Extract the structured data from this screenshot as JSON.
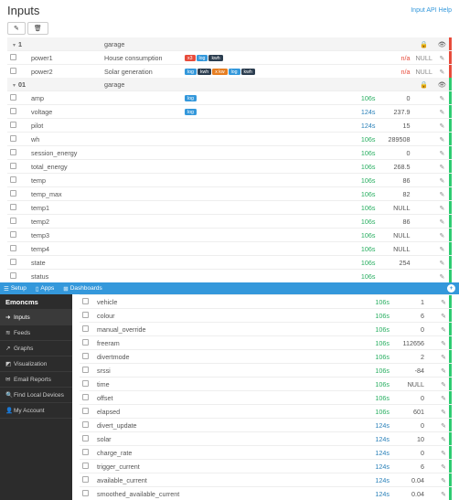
{
  "page_title": "Inputs",
  "api_link": "Input API Help",
  "toolbar": {
    "edit": "✎",
    "trash": "🗑"
  },
  "groups": [
    {
      "id": "1",
      "label": "garage",
      "bar": "b-red",
      "rows": [
        {
          "name": "power1",
          "desc": "House consumption",
          "tags": [
            [
              "t-red",
              "x3"
            ],
            [
              "t-blue",
              "log"
            ],
            [
              "t-navy",
              "kwh"
            ]
          ],
          "dt": "",
          "dtClass": "",
          "val": "n/a",
          "valClass": "val-na",
          "null": "NULL"
        },
        {
          "name": "power2",
          "desc": "Solar generation",
          "tags": [
            [
              "t-blue",
              "log"
            ],
            [
              "t-navy",
              "kwh"
            ],
            [
              "t-orange",
              "x kw"
            ],
            [
              "t-blue",
              "log"
            ],
            [
              "t-navy",
              "kwh"
            ]
          ],
          "dt": "",
          "dtClass": "",
          "val": "n/a",
          "valClass": "val-na",
          "null": "NULL"
        }
      ]
    },
    {
      "id": "01",
      "label": "garage",
      "bar": "b-green",
      "rows": [
        {
          "name": "amp",
          "desc": "",
          "tags": [
            [
              "t-blue",
              "log"
            ]
          ],
          "dt": "106s",
          "dtClass": "dt-106",
          "val": "0",
          "null": ""
        },
        {
          "name": "voltage",
          "desc": "",
          "tags": [
            [
              "t-blue",
              "log"
            ]
          ],
          "dt": "124s",
          "dtClass": "dt-124",
          "val": "237.9",
          "null": ""
        },
        {
          "name": "pilot",
          "desc": "",
          "tags": [],
          "dt": "124s",
          "dtClass": "dt-124",
          "val": "15",
          "null": ""
        },
        {
          "name": "wh",
          "desc": "",
          "tags": [],
          "dt": "106s",
          "dtClass": "dt-106",
          "val": "289508",
          "null": ""
        },
        {
          "name": "session_energy",
          "desc": "",
          "tags": [],
          "dt": "106s",
          "dtClass": "dt-106",
          "val": "0",
          "null": ""
        },
        {
          "name": "total_energy",
          "desc": "",
          "tags": [],
          "dt": "106s",
          "dtClass": "dt-106",
          "val": "268.5",
          "null": ""
        },
        {
          "name": "temp",
          "desc": "",
          "tags": [],
          "dt": "106s",
          "dtClass": "dt-106",
          "val": "86",
          "null": ""
        },
        {
          "name": "temp_max",
          "desc": "",
          "tags": [],
          "dt": "106s",
          "dtClass": "dt-106",
          "val": "82",
          "null": ""
        },
        {
          "name": "temp1",
          "desc": "",
          "tags": [],
          "dt": "106s",
          "dtClass": "dt-106",
          "val": "NULL",
          "null": ""
        },
        {
          "name": "temp2",
          "desc": "",
          "tags": [],
          "dt": "106s",
          "dtClass": "dt-106",
          "val": "86",
          "null": ""
        },
        {
          "name": "temp3",
          "desc": "",
          "tags": [],
          "dt": "106s",
          "dtClass": "dt-106",
          "val": "NULL",
          "null": ""
        },
        {
          "name": "temp4",
          "desc": "",
          "tags": [],
          "dt": "106s",
          "dtClass": "dt-106",
          "val": "NULL",
          "null": ""
        },
        {
          "name": "state",
          "desc": "",
          "tags": [],
          "dt": "106s",
          "dtClass": "dt-106",
          "val": "254",
          "null": ""
        },
        {
          "name": "status",
          "desc": "",
          "tags": [],
          "dt": "106s",
          "dtClass": "dt-106",
          "val": "",
          "null": ""
        }
      ]
    }
  ],
  "nav": {
    "setup": "Setup",
    "apps": "Apps",
    "dash": "Dashboards"
  },
  "sidebar": {
    "brand": "Emoncms",
    "items": [
      {
        "icon": "➜",
        "label": "Inputs",
        "active": true
      },
      {
        "icon": "≋",
        "label": "Feeds"
      },
      {
        "icon": "↗",
        "label": "Graphs"
      },
      {
        "icon": "◩",
        "label": "Visualization"
      },
      {
        "icon": "✉",
        "label": "Email Reports"
      },
      {
        "icon": "🔍",
        "label": "Find Local Devices"
      },
      {
        "icon": "👤",
        "label": "My Account"
      }
    ]
  },
  "rows2": [
    {
      "name": "vehicle",
      "dt": "106s",
      "dtClass": "dt-106",
      "val": "1"
    },
    {
      "name": "colour",
      "dt": "106s",
      "dtClass": "dt-106",
      "val": "6"
    },
    {
      "name": "manual_override",
      "dt": "106s",
      "dtClass": "dt-106",
      "val": "0"
    },
    {
      "name": "freeram",
      "dt": "106s",
      "dtClass": "dt-106",
      "val": "112656"
    },
    {
      "name": "divertmode",
      "dt": "106s",
      "dtClass": "dt-106",
      "val": "2"
    },
    {
      "name": "srssi",
      "dt": "106s",
      "dtClass": "dt-106",
      "val": "-84"
    },
    {
      "name": "time",
      "dt": "106s",
      "dtClass": "dt-106",
      "val": "NULL"
    },
    {
      "name": "offset",
      "dt": "106s",
      "dtClass": "dt-106",
      "val": "0"
    },
    {
      "name": "elapsed",
      "dt": "106s",
      "dtClass": "dt-106",
      "val": "601"
    },
    {
      "name": "divert_update",
      "dt": "124s",
      "dtClass": "dt-124",
      "val": "0"
    },
    {
      "name": "solar",
      "dt": "124s",
      "dtClass": "dt-124",
      "val": "10"
    },
    {
      "name": "charge_rate",
      "dt": "124s",
      "dtClass": "dt-124",
      "val": "0"
    },
    {
      "name": "trigger_current",
      "dt": "124s",
      "dtClass": "dt-124",
      "val": "6"
    },
    {
      "name": "available_current",
      "dt": "124s",
      "dtClass": "dt-124",
      "val": "0.04"
    },
    {
      "name": "smoothed_available_current",
      "dt": "124s",
      "dtClass": "dt-124",
      "val": "0.04"
    }
  ]
}
